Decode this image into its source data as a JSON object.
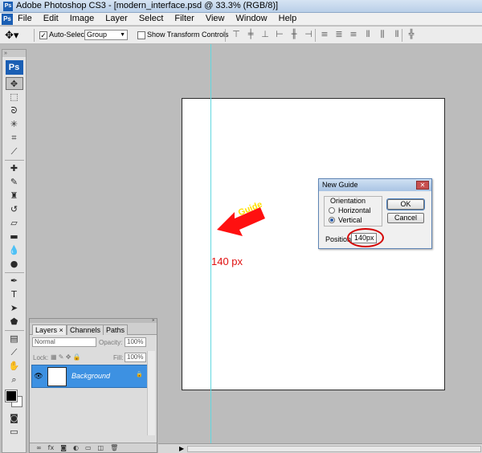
{
  "window": {
    "title": "Adobe Photoshop CS3 - [modern_interface.psd @ 33.3% (RGB/8)]",
    "app_logo": "Ps"
  },
  "menubar": {
    "logo": "Ps",
    "items": [
      "File",
      "Edit",
      "Image",
      "Layer",
      "Select",
      "Filter",
      "View",
      "Window",
      "Help"
    ]
  },
  "options_bar": {
    "move_tool_icon": "move-tool-icon",
    "auto_select_label": "Auto-Select:",
    "auto_select_checked": true,
    "auto_select_value": "Group",
    "show_transform_label": "Show Transform Controls",
    "show_transform_checked": false,
    "align_icons": [
      "align-top-icon",
      "align-vcenter-icon",
      "align-bottom-icon",
      "align-left-icon",
      "align-hcenter-icon",
      "align-right-icon",
      "distribute-top-icon",
      "distribute-vcenter-icon",
      "distribute-bottom-icon",
      "distribute-left-icon",
      "distribute-hcenter-icon",
      "distribute-right-icon",
      "auto-align-icon"
    ]
  },
  "toolbox": {
    "logo": "Ps",
    "tools": [
      "move-tool",
      "marquee-tool",
      "lasso-tool",
      "magic-wand-tool",
      "crop-tool",
      "slice-tool",
      "healing-brush-tool",
      "brush-tool",
      "clone-stamp-tool",
      "history-brush-tool",
      "eraser-tool",
      "gradient-tool",
      "blur-tool",
      "dodge-tool",
      "pen-tool",
      "type-tool",
      "path-selection-tool",
      "shape-tool",
      "notes-tool",
      "eyedropper-tool",
      "hand-tool",
      "zoom-tool"
    ],
    "foreground_color": "#000000",
    "background_color": "#ffffff"
  },
  "annotation": {
    "arrow_label": "Guide",
    "position_label": "140 px",
    "arrow_color": "#ff1010",
    "label_color": "#e01010",
    "arrow_text_color": "#ffe000"
  },
  "dialog": {
    "title": "New Guide",
    "orientation_label": "Orientation",
    "options": [
      {
        "label": "Horizontal",
        "selected": false
      },
      {
        "label": "Vertical",
        "selected": true
      }
    ],
    "ok_label": "OK",
    "cancel_label": "Cancel",
    "position_label": "Position:",
    "position_value": "140px"
  },
  "layers_panel": {
    "tabs": [
      {
        "label": "Layers",
        "active": true
      },
      {
        "label": "Channels",
        "active": false
      },
      {
        "label": "Paths",
        "active": false
      }
    ],
    "blend_mode": "Normal",
    "opacity_label": "Opacity:",
    "opacity_value": "100%",
    "lock_label": "Lock:",
    "fill_label": "Fill:",
    "fill_value": "100%",
    "layers": [
      {
        "name": "Background",
        "visible": true,
        "locked": true,
        "selected": true
      }
    ],
    "footer_icons": [
      "link-layers-icon",
      "layer-style-icon",
      "layer-mask-icon",
      "adjustment-layer-icon",
      "new-group-icon",
      "new-layer-icon",
      "delete-layer-icon"
    ]
  },
  "colors": {
    "guide": "#62d8e0",
    "layer_selected": "#3d91e2",
    "workspace": "#bcbcbc"
  }
}
